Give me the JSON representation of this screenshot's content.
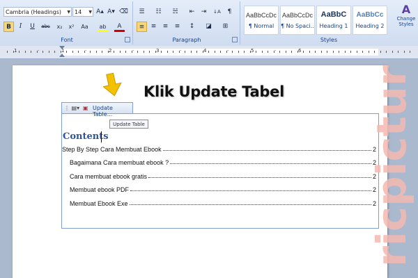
{
  "ribbon": {
    "font_group": {
      "font_name": "Cambria (Headings)",
      "font_size": "14",
      "label": "Font",
      "grow_icon": "A▴",
      "shrink_icon": "A▾",
      "clear_icon": "⌫",
      "bold": "B",
      "italic": "I",
      "underline": "U",
      "strike": "abc",
      "subscript": "x₂",
      "superscript": "x²",
      "case": "Aa",
      "highlight": "ab",
      "font_color": "A"
    },
    "paragraph_group": {
      "label": "Paragraph",
      "bullets": "☰",
      "numbering": "☷",
      "multilevel": "☵",
      "decrease_indent": "⇤",
      "increase_indent": "⇥",
      "sort": "↓A",
      "pilcrow": "¶",
      "align_left": "≡",
      "center": "≡",
      "align_right": "≡",
      "justify": "≡",
      "line_spacing": "↕",
      "shading": "◪",
      "borders": "⊞"
    },
    "styles_group": {
      "label": "Styles",
      "styles": [
        {
          "sample": "AaBbCcDc",
          "name": "¶ Normal"
        },
        {
          "sample": "AaBbCcDc",
          "name": "¶ No Spaci..."
        },
        {
          "sample": "AaBbC",
          "name": "Heading 1"
        },
        {
          "sample": "AaBbCc",
          "name": "Heading 2"
        }
      ],
      "change_styles": "Change Styles",
      "change_icon": "A"
    }
  },
  "ruler": {
    "numbers": [
      "1",
      "·",
      "1",
      "·",
      "2",
      "·",
      "3",
      "·",
      "4",
      "·",
      "5",
      "·",
      "6"
    ]
  },
  "toc_control": {
    "update_label": "Update Table...",
    "tooltip": "Update Table",
    "heading": "Contents",
    "entries": [
      {
        "title": "Step By Step Cara Membuat Ebook",
        "page": "2",
        "level": 1
      },
      {
        "title": "Bagaimana Cara membuat ebook ?",
        "page": "2",
        "level": 2
      },
      {
        "title": "Cara membuat ebook gratis",
        "page": "2",
        "level": 2
      },
      {
        "title": "Membuat ebook PDF",
        "page": "2",
        "level": 2
      },
      {
        "title": "Membuat Ebook Exe",
        "page": "2",
        "level": 2
      }
    ]
  },
  "annotation": {
    "text": "Klik Update Tabel"
  },
  "watermark": {
    "text": "ricpictur"
  },
  "colors": {
    "arrow": "#f2c200",
    "heading": "#2f5597",
    "accent": "#15428b",
    "watermark": "#f3b9b0"
  }
}
